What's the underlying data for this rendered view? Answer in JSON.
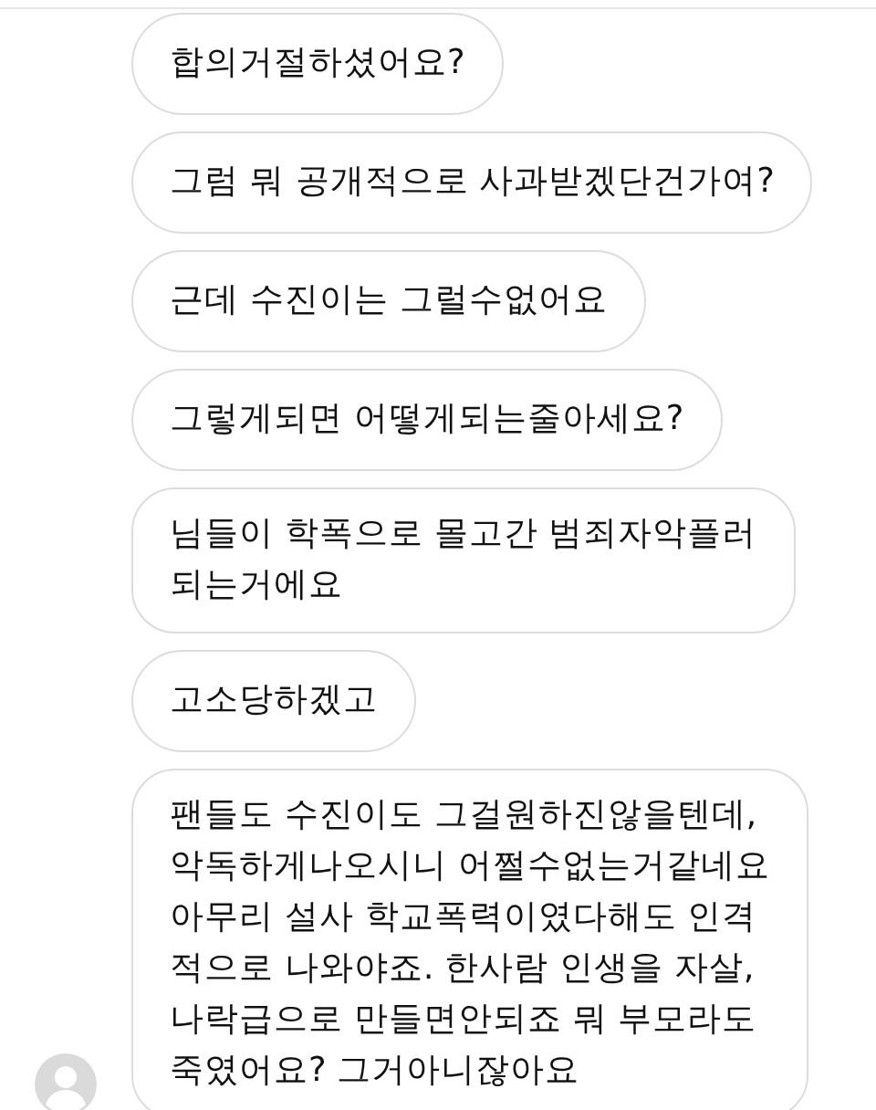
{
  "messages": [
    {
      "text": "합의거절하셨어요?",
      "show_avatar": false
    },
    {
      "text": "그럼 뭐 공개적으로 사과받겠단건가여?",
      "show_avatar": false
    },
    {
      "text": "근데 수진이는 그럴수없어요",
      "show_avatar": false
    },
    {
      "text": "그렇게되면 어떻게되는줄아세요?",
      "show_avatar": false
    },
    {
      "text": "님들이 학폭으로 몰고간 범죄자악플러\n되는거에요",
      "show_avatar": false
    },
    {
      "text": "고소당하겠고",
      "show_avatar": false
    },
    {
      "text": "팬들도 수진이도 그걸원하진않을텐데,\n악독하게나오시니 어쩔수없는거같네요\n아무리 설사 학교폭력이였다해도 인격\n적으로 나와야죠. 한사람 인생을 자살,\n나락급으로 만들면안되죠 뭐 부모라도\n죽였어요? 그거아니잖아요",
      "show_avatar": true
    }
  ]
}
